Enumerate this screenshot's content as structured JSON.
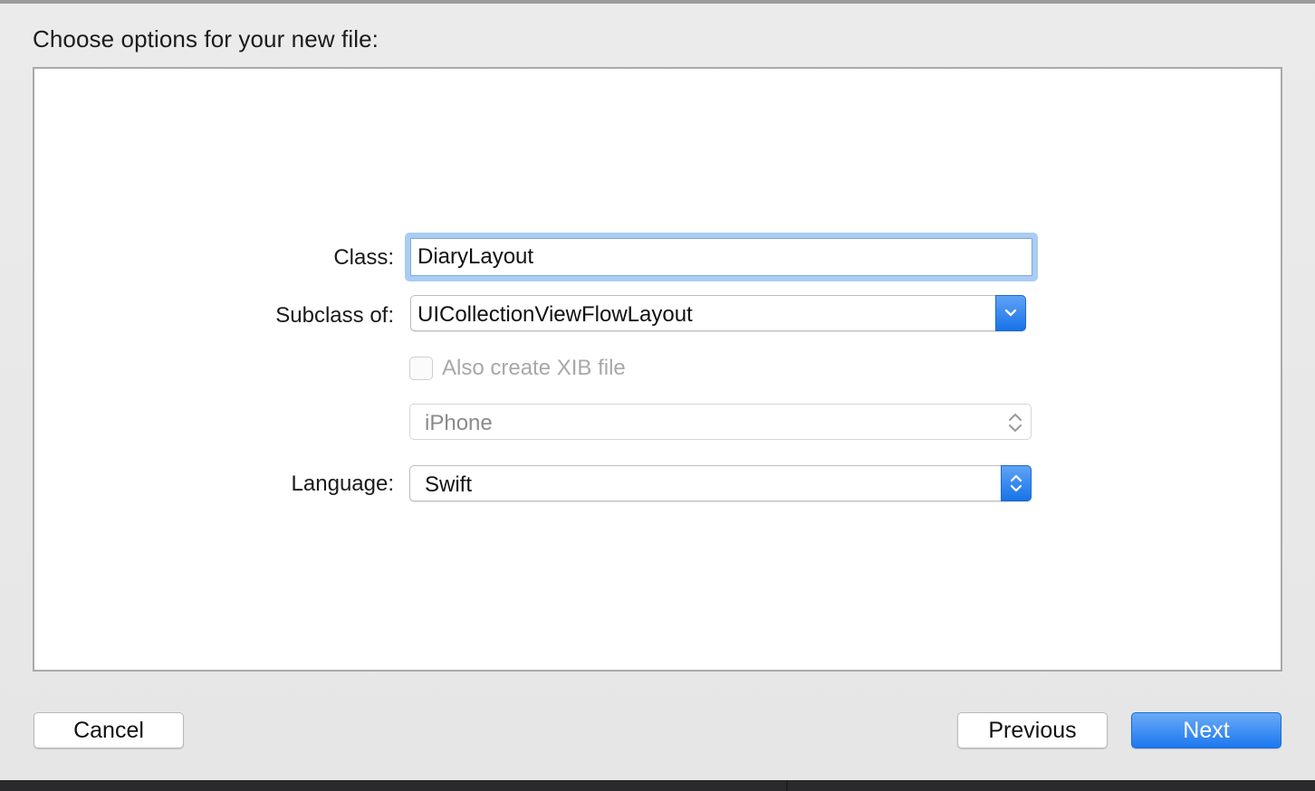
{
  "dialog": {
    "title": "Choose options for your new file:"
  },
  "form": {
    "class_label": "Class:",
    "class_value": "DiaryLayout",
    "subclass_label": "Subclass of:",
    "subclass_value": "UICollectionViewFlowLayout",
    "xib_checkbox_label": "Also create XIB file",
    "xib_checked": false,
    "device_value": "iPhone",
    "language_label": "Language:",
    "language_value": "Swift"
  },
  "buttons": {
    "cancel": "Cancel",
    "previous": "Previous",
    "next": "Next"
  },
  "icons": {
    "subclass_dropdown": "chevron-down-icon",
    "device_stepper": "up-down-chevron-icon",
    "language_stepper": "up-down-chevron-icon"
  },
  "colors": {
    "accent": "#1d78ef",
    "focus_ring": "#a9cdf3"
  }
}
